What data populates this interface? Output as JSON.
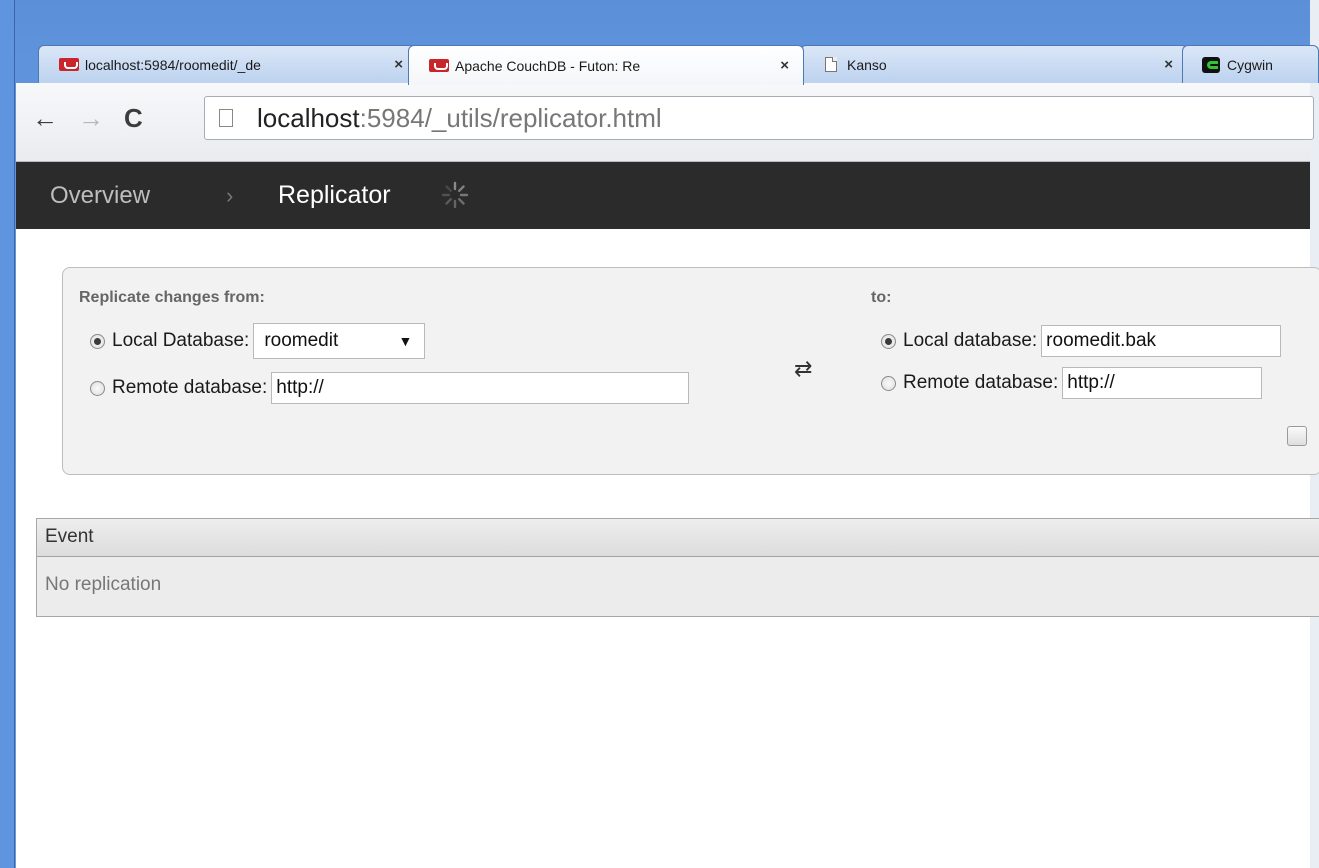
{
  "tabs": [
    {
      "title": "localhost:5984/roomedit/_de",
      "icon": "couchdb-favicon",
      "close": "×",
      "active": false
    },
    {
      "title": "Apache CouchDB - Futon: Re",
      "icon": "couchdb-favicon",
      "close": "×",
      "active": true
    },
    {
      "title": "Kanso",
      "icon": "document-icon",
      "close": "×",
      "active": false
    },
    {
      "title": "Cygwin",
      "icon": "cygwin-icon",
      "close": "",
      "active": false
    }
  ],
  "toolbar": {
    "back": "←",
    "forward": "→",
    "reload": "C",
    "url_host": "localhost",
    "url_path": ":5984/_utils/replicator.html"
  },
  "header": {
    "overview": "Overview",
    "separator": "›",
    "current": "Replicator"
  },
  "form": {
    "from_label": "Replicate changes from:",
    "to_label": "to:",
    "source_local_label": "Local Database:",
    "source_local_value": "roomedit",
    "source_local_arrow": "▼",
    "source_remote_label": "Remote database:",
    "source_remote_value": "http://",
    "swap": "⇄",
    "target_local_label": "Local database:",
    "target_local_value": "roomedit.bak",
    "target_remote_label": "Remote database:",
    "target_remote_value": "http://"
  },
  "events": {
    "header": "Event",
    "status": "No replication"
  }
}
